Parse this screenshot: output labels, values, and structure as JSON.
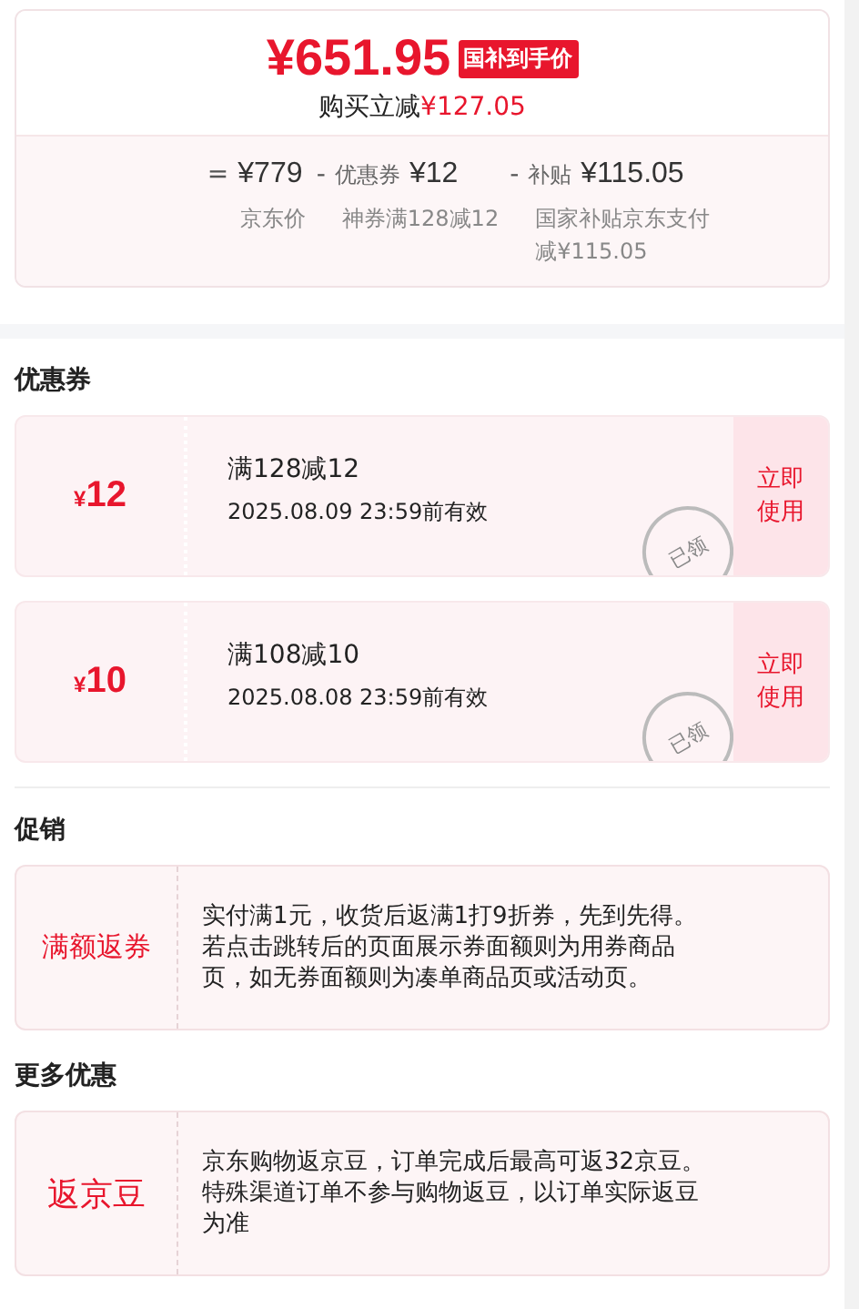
{
  "price": {
    "amount": "¥651.95",
    "tag": "国补到手价",
    "saving_label": "购买立减",
    "saving_value": "¥127.05"
  },
  "breakdown": [
    {
      "op": "=",
      "value": "¥779",
      "note": "京东价"
    },
    {
      "op": "-",
      "name": "优惠券",
      "value": "¥12",
      "note": "神券满128减12"
    },
    {
      "op": "-",
      "name": "补贴",
      "value": "¥115.05",
      "note": "国家补贴京东支付减¥115.05"
    }
  ],
  "coupons": {
    "title": "优惠券",
    "items": [
      {
        "amount": "12",
        "currency": "¥",
        "condition": "满128减12",
        "validity": "2025.08.09 23:59前有效",
        "action": "立即使用",
        "claimed": true,
        "stamp": "已领"
      },
      {
        "amount": "10",
        "currency": "¥",
        "condition": "满108减10",
        "validity": "2025.08.08 23:59前有效",
        "action": "立即使用",
        "claimed": true,
        "stamp": "已领"
      }
    ]
  },
  "sections": [
    {
      "title": "促销",
      "label": "满额返券",
      "text": "实付满1元，收货后返满1打9折券，先到先得。若点击跳转后的页面展示券面额则为用券商品页，如无券面额则为凑单商品页或活动页。"
    },
    {
      "title": "更多优惠",
      "label": "返京豆",
      "text": "京东购物返京豆，订单完成后最高可返32京豆。特殊渠道订单不参与购物返豆，以订单实际返豆为准"
    }
  ]
}
